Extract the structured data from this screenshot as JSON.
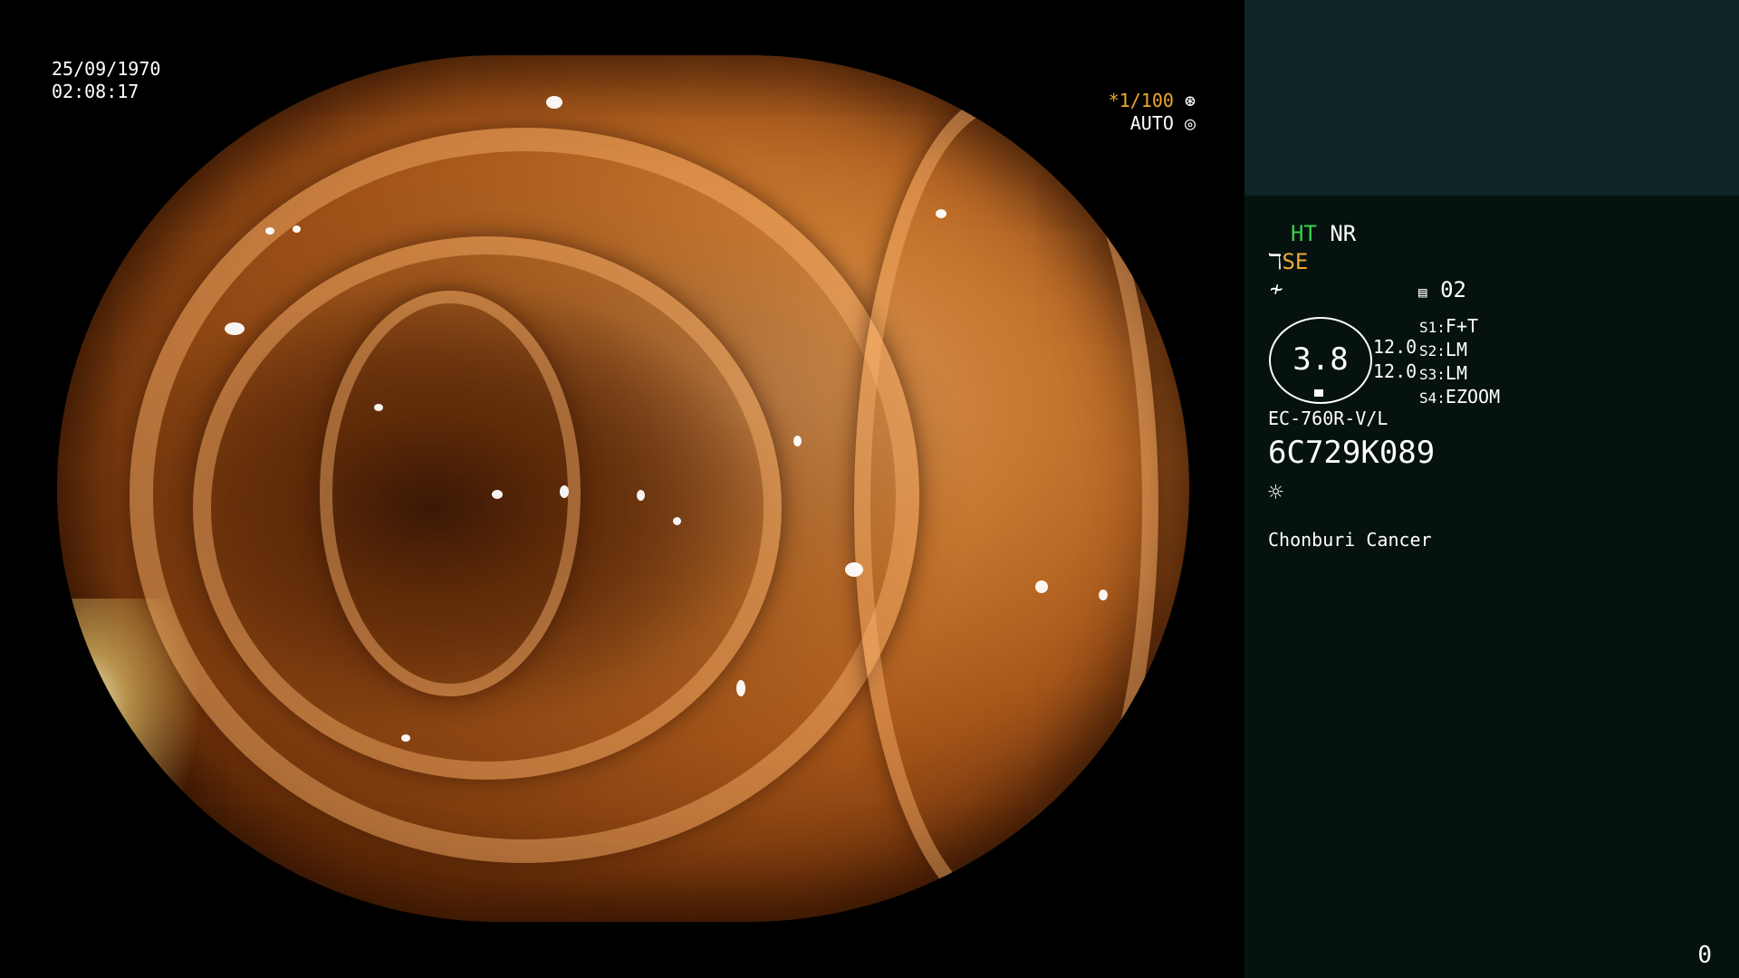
{
  "overlay": {
    "date": "25/09/1970",
    "time": "02:08:17",
    "shutter": "*1/100",
    "iris_mode": "AUTO"
  },
  "panel": {
    "ht": "HT",
    "nr": "NR",
    "se": "SE",
    "memo": "02",
    "zoom_value": "3.8",
    "value_a": "12.0",
    "value_b": "12.0",
    "switches": [
      {
        "key": "S1:",
        "value": "F+T"
      },
      {
        "key": "S2:",
        "value": "LM"
      },
      {
        "key": "S3:",
        "value": "LM"
      },
      {
        "key": "S4:",
        "value": "EZOOM"
      }
    ],
    "scope_model": "EC-760R-V/L",
    "serial": "6C729K089",
    "institution": "Chonburi Cancer",
    "frame_count": "0"
  },
  "icons": {
    "aperture": "aperture-icon",
    "iris": "iris-icon",
    "scope": "scope-icon",
    "enhancement": "enhancement-icon",
    "memory": "memory-icon",
    "light": "light-icon"
  },
  "colors": {
    "green": "#39d24a",
    "amber": "#f0a830",
    "panel_top": "#0e2426",
    "panel_bottom": "#061210"
  }
}
